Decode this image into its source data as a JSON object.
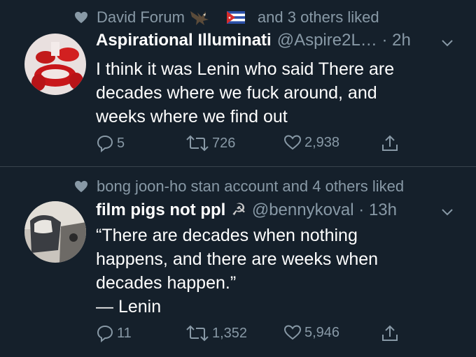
{
  "tweets": [
    {
      "social_context": {
        "before": "David Forum",
        "after": "and 3 others liked"
      },
      "author_name": "Aspirational Illuminati",
      "handle_time": "@Aspire2L… · 2h",
      "body_lines": [
        "I think it was Lenin who said There are",
        "decades where we fuck around, and",
        "weeks where we find out"
      ],
      "replies": "5",
      "retweets": "726",
      "likes": "2,938"
    },
    {
      "social_context": {
        "before": "bong joon-ho stan account and 4 others liked"
      },
      "author_name": "film pigs not ppl",
      "author_emoji": "☭",
      "handle_time": "@bennykoval · 13h",
      "body_lines": [
        "“There are decades when nothing",
        "happens, and there are weeks when",
        "decades happen.”",
        "— Lenin"
      ],
      "replies": "11",
      "retweets": "1,352",
      "likes": "5,946"
    }
  ],
  "colors": {
    "background": "#15202b",
    "secondary_text": "#8899a6",
    "divider": "#38444d"
  }
}
